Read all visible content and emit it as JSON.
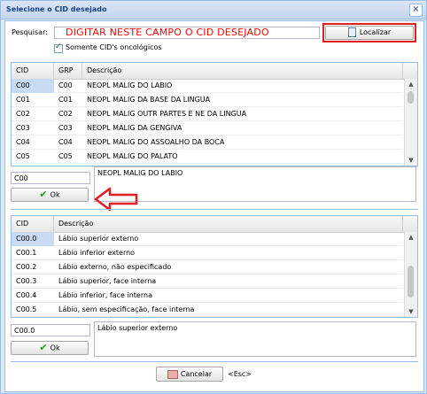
{
  "window": {
    "title": "Selecione o CID desejado",
    "close_label": "×"
  },
  "search": {
    "label": "Pesquisar:",
    "value": "",
    "hint": "DIGITAR NESTE CAMPO O CID DESEJADO",
    "button_label": "Localizar",
    "checkbox_label": "Somente CID's oncológicos",
    "checkbox_checked": true
  },
  "grid1": {
    "columns": [
      "CID",
      "GRP",
      "Descrição"
    ],
    "rows": [
      [
        "C00",
        "C00",
        "NEOPL MALIG DO LABIO"
      ],
      [
        "C01",
        "C01",
        "NEOPL MALIG DA BASE DA LINGUA"
      ],
      [
        "C02",
        "C02",
        "NEOPL MALIG OUTR PARTES E NE DA LINGUA"
      ],
      [
        "C03",
        "C03",
        "NEOPL MALIG DA GENGIVA"
      ],
      [
        "C04",
        "C04",
        "NEOPL MALIG DO ASSOALHO DA BOCA"
      ],
      [
        "C05",
        "C05",
        "NEOPL MALIG DO PALATO"
      ]
    ],
    "selected_code": "C00",
    "selected_desc": "NEOPL MALIG DO LABIO",
    "ok_label": "Ok"
  },
  "grid2": {
    "columns": [
      "CID",
      "Descrição"
    ],
    "rows": [
      [
        "C00.0",
        "Lábio superior externo"
      ],
      [
        "C00.1",
        "Lábio inferior externo"
      ],
      [
        "C00.2",
        "Lábio externo, não especificado"
      ],
      [
        "C00.3",
        "Lábio superior, face interna"
      ],
      [
        "C00.4",
        "Lábio inferior, face interna"
      ],
      [
        "C00.5",
        "Lábio, sem especificação, face interna"
      ]
    ],
    "selected_code": "C00.0",
    "selected_desc": "Lábio superior externo",
    "ok_label": "Ok"
  },
  "footer": {
    "cancel_label": "Cancelar",
    "esc_hint": "<Esc>"
  },
  "colors": {
    "accent": "#15428b",
    "highlight": "#e02020",
    "selection": "#c9dbf3"
  }
}
